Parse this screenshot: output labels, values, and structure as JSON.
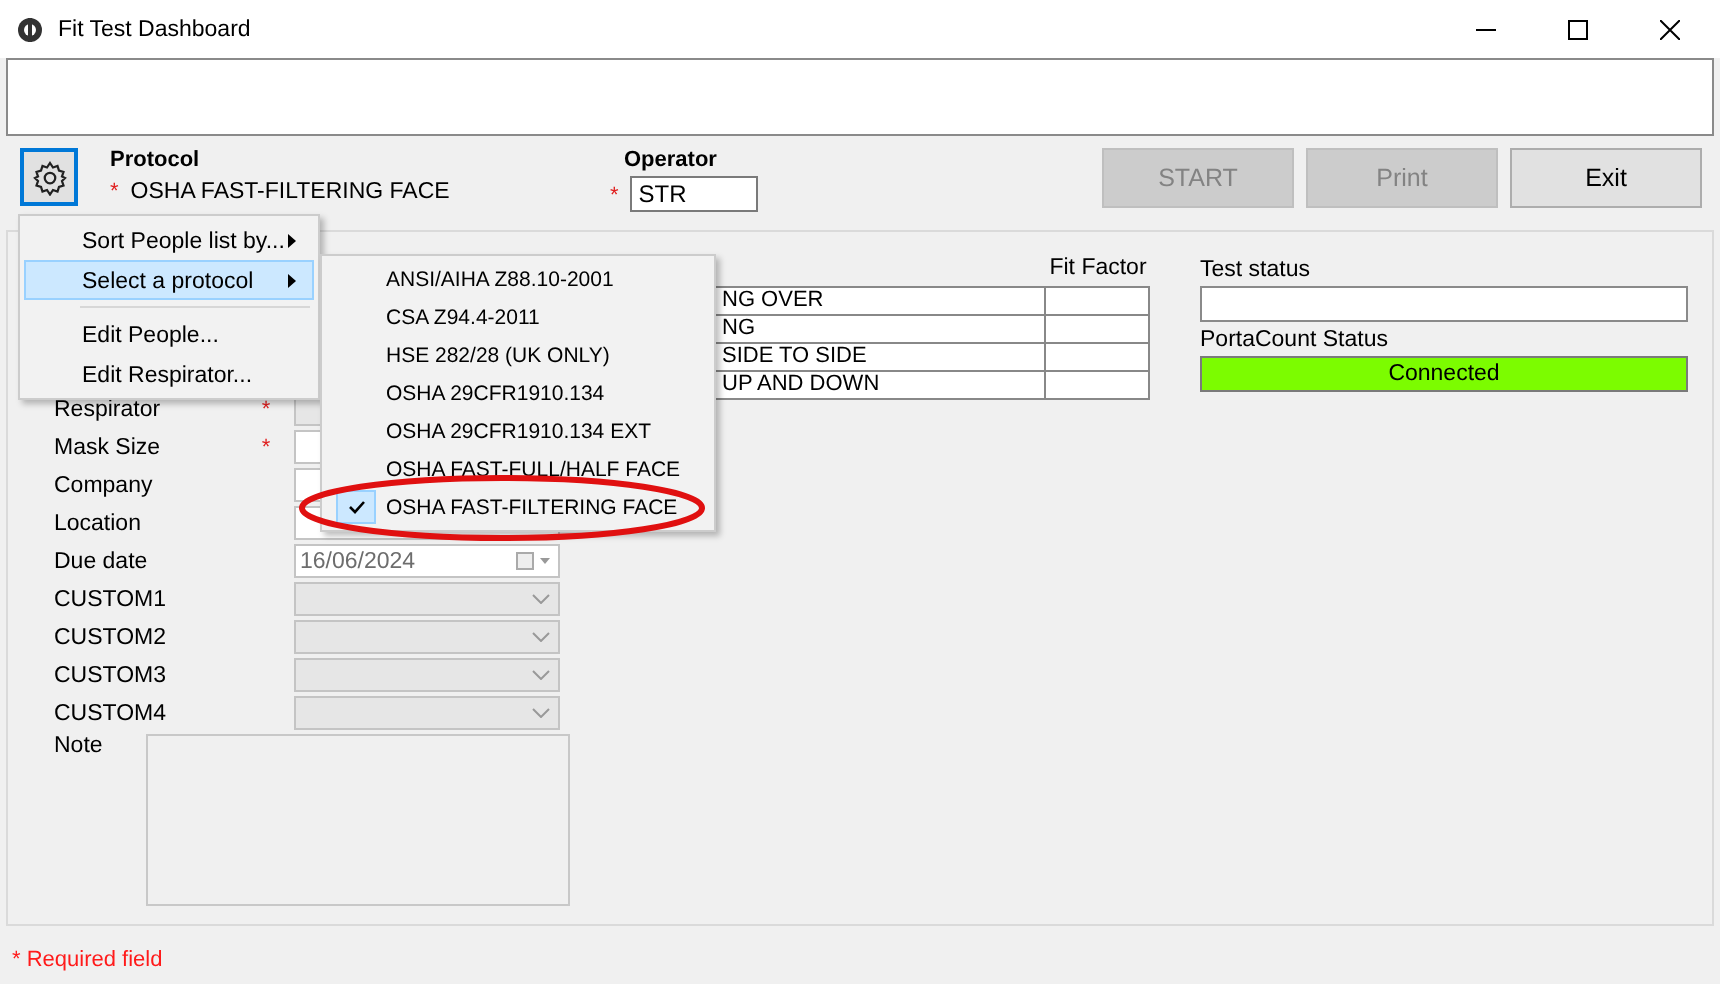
{
  "window": {
    "title": "Fit Test Dashboard"
  },
  "protocol": {
    "label": "Protocol",
    "required_mark": "*",
    "value": "OSHA FAST-FILTERING FACE"
  },
  "operator": {
    "label": "Operator",
    "required_mark": "*",
    "value": "STR"
  },
  "buttons": [
    {
      "label": "START",
      "disabled": true
    },
    {
      "label": "Print",
      "disabled": true
    },
    {
      "label": "Exit",
      "disabled": false
    }
  ],
  "exercises": {
    "fit_factor_header": "Fit Factor",
    "rows": [
      "NG OVER",
      "NG",
      "SIDE TO SIDE",
      "UP AND DOWN"
    ]
  },
  "test_status": {
    "label": "Test status"
  },
  "portacount_status": {
    "label": "PortaCount Status",
    "value": "Connected",
    "connected": true
  },
  "form": {
    "fields": [
      {
        "label": "Respirator",
        "required_mark": "*",
        "kind": "select",
        "disabled": true
      },
      {
        "label": "Mask Size",
        "required_mark": "*",
        "kind": "select",
        "disabled": false
      },
      {
        "label": "Company",
        "kind": "select",
        "disabled": false
      },
      {
        "label": "Location",
        "kind": "select",
        "disabled": false
      },
      {
        "label": "Due date",
        "kind": "date",
        "value": "16/06/2024"
      },
      {
        "label": "CUSTOM1",
        "kind": "select",
        "disabled": true
      },
      {
        "label": "CUSTOM2",
        "kind": "select",
        "disabled": true
      },
      {
        "label": "CUSTOM3",
        "kind": "select",
        "disabled": true
      },
      {
        "label": "CUSTOM4",
        "kind": "select",
        "disabled": true
      },
      {
        "label": "Note",
        "kind": "textarea",
        "disabled": true
      }
    ]
  },
  "context_menu": {
    "items": [
      {
        "kind": "item",
        "label": "Sort People list by...",
        "submenu": true,
        "selected": false
      },
      {
        "kind": "item",
        "label": "Select a protocol",
        "submenu": true,
        "selected": true
      },
      {
        "kind": "separator"
      },
      {
        "kind": "item",
        "label": "Edit People...",
        "submenu": false,
        "selected": false
      },
      {
        "kind": "item",
        "label": "Edit Respirator...",
        "submenu": false,
        "selected": false
      }
    ]
  },
  "protocol_menu": {
    "items": [
      {
        "label": "ANSI/AIHA  Z88.10-2001",
        "checked": false
      },
      {
        "label": "CSA Z94.4-2011",
        "checked": false
      },
      {
        "label": "HSE 282/28 (UK ONLY)",
        "checked": false
      },
      {
        "label": "OSHA 29CFR1910.134",
        "checked": false
      },
      {
        "label": "OSHA 29CFR1910.134 EXT",
        "checked": false
      },
      {
        "label": "OSHA FAST-FULL/HALF FACE",
        "checked": false
      },
      {
        "label": "OSHA FAST-FILTERING FACE",
        "checked": true
      }
    ]
  },
  "footer": {
    "required_note": "* Required field"
  }
}
